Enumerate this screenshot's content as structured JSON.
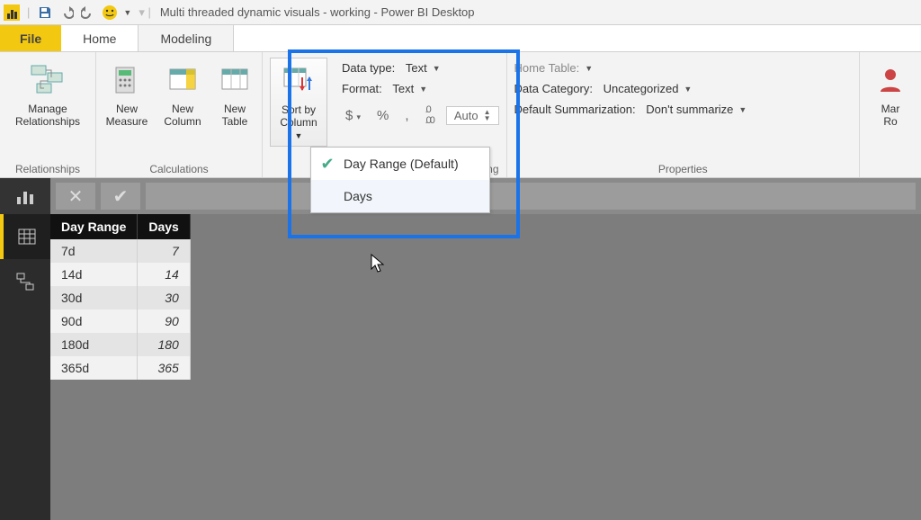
{
  "window_title": "Multi threaded dynamic visuals - working - Power BI Desktop",
  "tabs": {
    "file": "File",
    "home": "Home",
    "modeling": "Modeling"
  },
  "ribbon": {
    "relationships": {
      "manage": "Manage\nRelationships",
      "group": "Relationships"
    },
    "calculations": {
      "measure": "New\nMeasure",
      "column": "New\nColumn",
      "table": "New\nTable",
      "group": "Calculations"
    },
    "sort": {
      "button": "Sort by\nColumn",
      "menu": [
        {
          "label": "Day Range (Default)",
          "checked": true
        },
        {
          "label": "Days",
          "checked": false
        }
      ]
    },
    "formatting": {
      "datatype_label": "Data type:",
      "datatype_value": "Text",
      "format_label": "Format:",
      "format_value": "Text",
      "auto": "Auto",
      "group_partial": "ting"
    },
    "properties": {
      "home_table": "Home Table:",
      "data_category_label": "Data Category:",
      "data_category_value": "Uncategorized",
      "summarization_label": "Default Summarization:",
      "summarization_value": "Don't summarize",
      "group": "Properties"
    },
    "right": {
      "manage_roles": "Mar\nRo"
    }
  },
  "table": {
    "headers": [
      "Day Range",
      "Days"
    ],
    "rows": [
      [
        "7d",
        "7"
      ],
      [
        "14d",
        "14"
      ],
      [
        "30d",
        "30"
      ],
      [
        "90d",
        "90"
      ],
      [
        "180d",
        "180"
      ],
      [
        "365d",
        "365"
      ]
    ]
  }
}
